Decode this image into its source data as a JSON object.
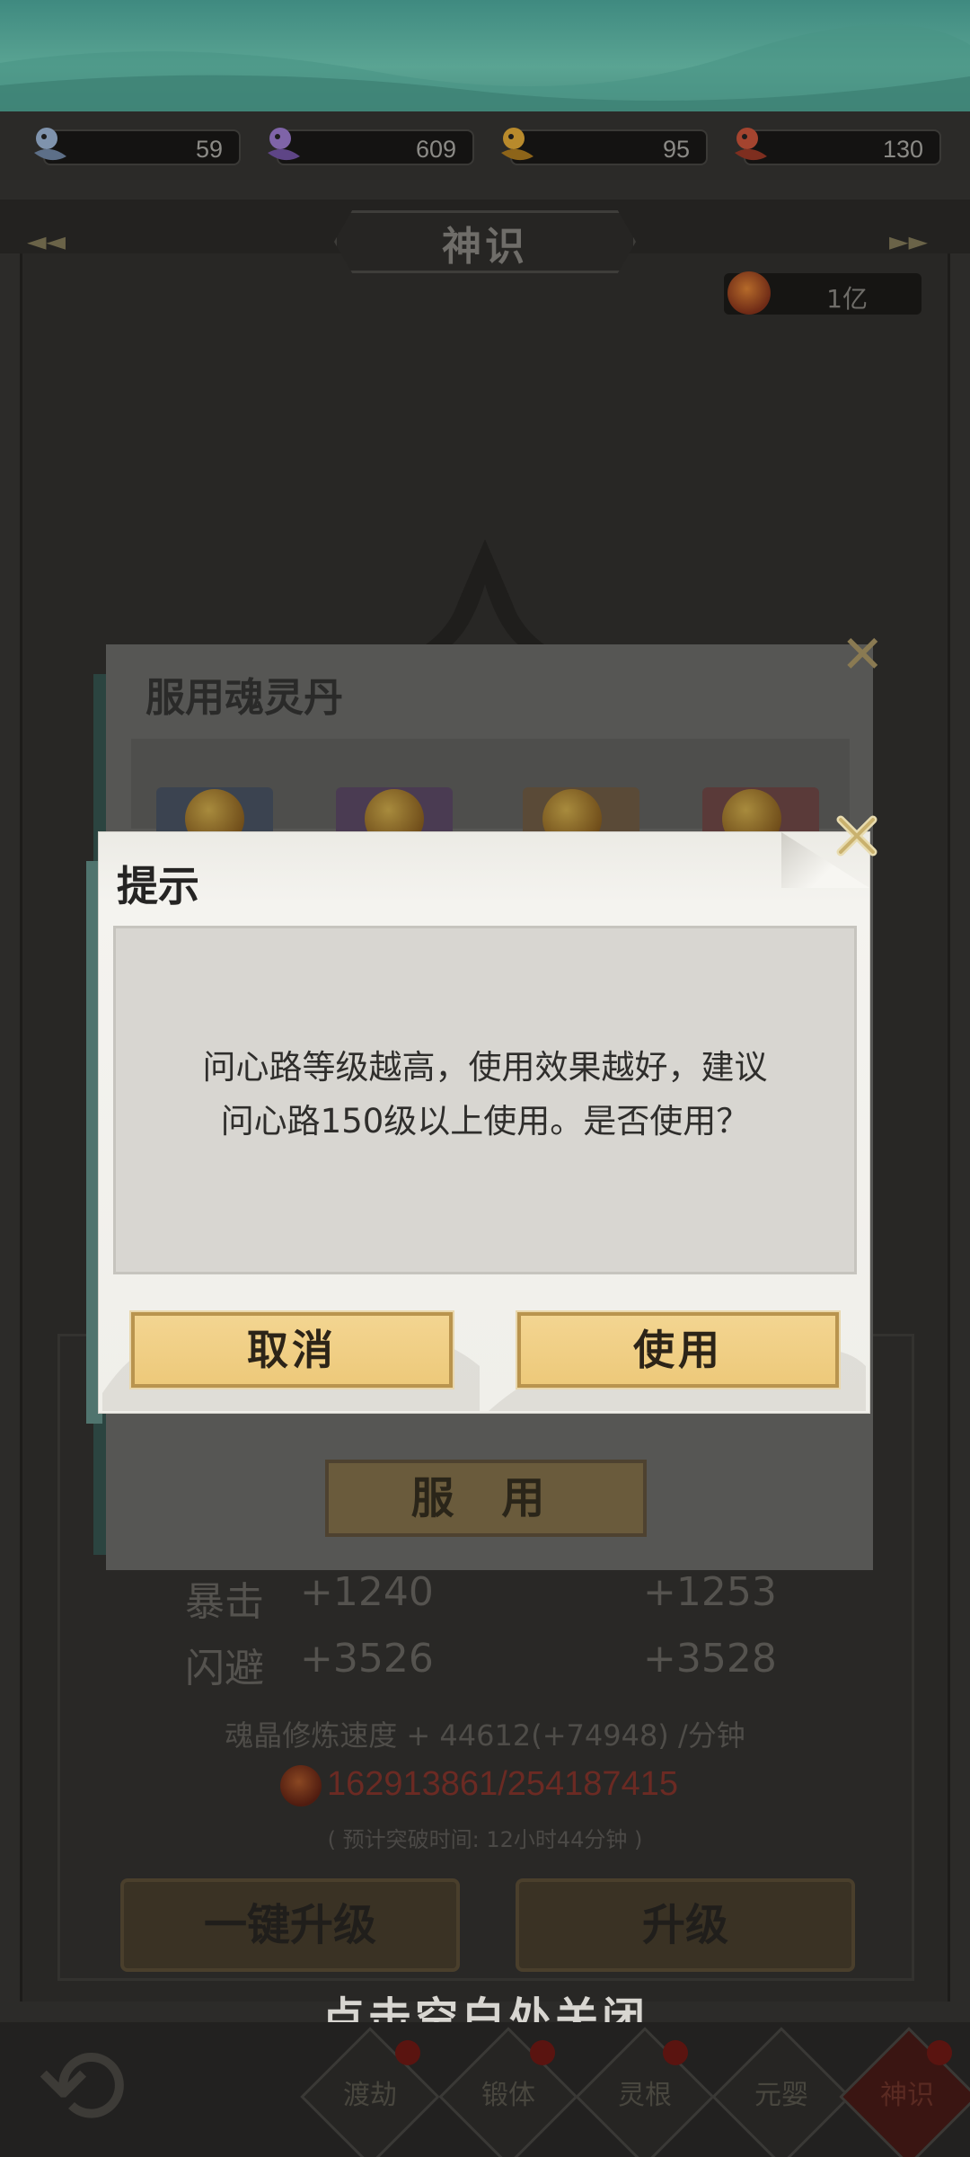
{
  "resources": [
    {
      "icon": "blue-soul-icon",
      "value": "59",
      "color": "#8ea5c4"
    },
    {
      "icon": "purple-soul-icon",
      "value": "609",
      "color": "#9a78c6"
    },
    {
      "icon": "gold-soul-icon",
      "value": "95",
      "color": "#d6a73a"
    },
    {
      "icon": "red-soul-icon",
      "value": "130",
      "color": "#c8553e"
    }
  ],
  "panel": {
    "title": "神识",
    "currency_value": "1亿"
  },
  "stats": [
    {
      "label": "暴击",
      "current": "+1240",
      "next": "+1253"
    },
    {
      "label": "闪避",
      "current": "+3526",
      "next": "+3528"
    }
  ],
  "cultivation": {
    "speed_text": "魂晶修炼速度 + 44612(+74948) /分钟",
    "progress_text": "162913861/254187415",
    "eta_text": "( 预计突破时间: 12小时44分钟 )"
  },
  "actions": {
    "one_click_upgrade": "一键升级",
    "upgrade": "升级"
  },
  "close_hint": "点击空白处关闭",
  "bottom_nav": [
    {
      "label": "渡劫"
    },
    {
      "label": "锻体"
    },
    {
      "label": "灵根"
    },
    {
      "label": "元婴"
    },
    {
      "label": "神识"
    }
  ],
  "pill_dialog": {
    "title": "服用魂灵丹",
    "serve_button": "服 用"
  },
  "tip_dialog": {
    "title": "提示",
    "message_line1": "问心路等级越高，使用效果越好，建议",
    "message_line2": "问心路150级以上使用。是否使用？",
    "cancel": "取消",
    "use": "使用"
  },
  "colors": {
    "button_gold": "#edc97a",
    "dialog_paper": "#f0efea",
    "accent_teal": "#5aa493",
    "progress_red": "#6b2a23"
  }
}
